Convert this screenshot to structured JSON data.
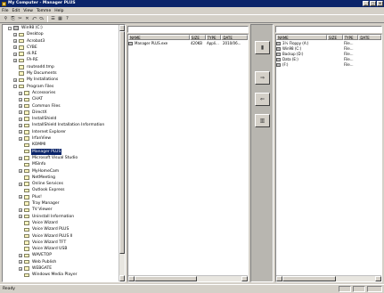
{
  "window": {
    "title": "My Computer - Manager PLUS",
    "min": "_",
    "max": "□",
    "close": "×"
  },
  "menu": [
    "File",
    "Edit",
    "View",
    "Tomme",
    "Help"
  ],
  "toolbar": [
    "⚲",
    "⎘",
    "✂",
    "✕",
    "⤺",
    "⤼",
    "☰",
    "▦",
    "?"
  ],
  "tree": [
    {
      "label": "Win98 (C:)",
      "indent": 3,
      "exp": "-",
      "icon": "drive",
      "selected": false
    },
    {
      "label": "Desktop",
      "indent": 4,
      "exp": "+",
      "icon": "folder",
      "selected": false
    },
    {
      "label": "Acrobat3",
      "indent": 4,
      "exp": "+",
      "icon": "folder",
      "selected": false
    },
    {
      "label": "CYBE",
      "indent": 4,
      "exp": "+",
      "icon": "folder",
      "selected": false
    },
    {
      "label": "di.RE",
      "indent": 4,
      "exp": "+",
      "icon": "folder",
      "selected": false
    },
    {
      "label": "FA-RE",
      "indent": 4,
      "exp": "+",
      "icon": "folder",
      "selected": false
    },
    {
      "label": "routeadd.tmp",
      "indent": 4,
      "exp": "",
      "icon": "folder",
      "selected": false
    },
    {
      "label": "My Documents",
      "indent": 4,
      "exp": "",
      "icon": "folder",
      "selected": false
    },
    {
      "label": "My Installations",
      "indent": 4,
      "exp": "+",
      "icon": "folder",
      "selected": false
    },
    {
      "label": "Program Files",
      "indent": 4,
      "exp": "-",
      "icon": "folder",
      "selected": false
    },
    {
      "label": "Accessories",
      "indent": 5,
      "exp": "+",
      "icon": "folder",
      "selected": false
    },
    {
      "label": "CHAT",
      "indent": 5,
      "exp": "+",
      "icon": "folder",
      "selected": false
    },
    {
      "label": "Common Files",
      "indent": 5,
      "exp": "+",
      "icon": "folder",
      "selected": false
    },
    {
      "label": "DirectX",
      "indent": 5,
      "exp": "+",
      "icon": "folder",
      "selected": false
    },
    {
      "label": "InstallShield",
      "indent": 5,
      "exp": "+",
      "icon": "folder",
      "selected": false
    },
    {
      "label": "InstallShield Installation Information",
      "indent": 5,
      "exp": "+",
      "icon": "folder",
      "selected": false
    },
    {
      "label": "Internet Explorer",
      "indent": 5,
      "exp": "+",
      "icon": "folder",
      "selected": false
    },
    {
      "label": "IrfanView",
      "indent": 5,
      "exp": "+",
      "icon": "folder",
      "selected": false
    },
    {
      "label": "KOMMI",
      "indent": 5,
      "exp": "",
      "icon": "folder",
      "selected": false
    },
    {
      "label": "Manager PLUS",
      "indent": 5,
      "exp": "",
      "icon": "folder",
      "selected": true
    },
    {
      "label": "Microsoft Visual Studio",
      "indent": 5,
      "exp": "+",
      "icon": "folder",
      "selected": false
    },
    {
      "label": "MSInfo",
      "indent": 5,
      "exp": "",
      "icon": "folder",
      "selected": false
    },
    {
      "label": "MyHomeCam",
      "indent": 5,
      "exp": "+",
      "icon": "folder",
      "selected": false
    },
    {
      "label": "NetMeeting",
      "indent": 5,
      "exp": "",
      "icon": "folder",
      "selected": false
    },
    {
      "label": "Online Services",
      "indent": 5,
      "exp": "+",
      "icon": "folder",
      "selected": false
    },
    {
      "label": "Outlook Express",
      "indent": 5,
      "exp": "",
      "icon": "folder",
      "selected": false
    },
    {
      "label": "Plus!",
      "indent": 5,
      "exp": "+",
      "icon": "folder",
      "selected": false
    },
    {
      "label": "Tray Manager",
      "indent": 5,
      "exp": "",
      "icon": "folder",
      "selected": false
    },
    {
      "label": "TV Viewer",
      "indent": 5,
      "exp": "+",
      "icon": "folder",
      "selected": false
    },
    {
      "label": "Uninstall Information",
      "indent": 5,
      "exp": "+",
      "icon": "folder",
      "selected": false
    },
    {
      "label": "Voice Wizard",
      "indent": 5,
      "exp": "",
      "icon": "folder",
      "selected": false
    },
    {
      "label": "Voice Wizard PLUS",
      "indent": 5,
      "exp": "",
      "icon": "folder",
      "selected": false
    },
    {
      "label": "Voice Wizard PLUS II",
      "indent": 5,
      "exp": "",
      "icon": "folder",
      "selected": false
    },
    {
      "label": "Voice Wizard TFT",
      "indent": 5,
      "exp": "",
      "icon": "folder",
      "selected": false
    },
    {
      "label": "Voice Wizard USB",
      "indent": 5,
      "exp": "",
      "icon": "folder",
      "selected": false
    },
    {
      "label": "WAVETOP",
      "indent": 5,
      "exp": "+",
      "icon": "folder",
      "selected": false
    },
    {
      "label": "Web Publish",
      "indent": 5,
      "exp": "+",
      "icon": "folder",
      "selected": false
    },
    {
      "label": "WEBGATE",
      "indent": 5,
      "exp": "+",
      "icon": "folder",
      "selected": false
    },
    {
      "label": "Windows Media Player",
      "indent": 5,
      "exp": "",
      "icon": "folder",
      "selected": false
    }
  ],
  "left_list": {
    "headers": [
      "NAME",
      "SIZE",
      "TYPE",
      "DATE"
    ],
    "rows": [
      {
        "name": "Manager PLUS.exe",
        "size": "420KB",
        "type": "Appli...",
        "date": "2010/06..."
      }
    ]
  },
  "right_list": {
    "headers": [
      "NAME",
      "SIZE",
      "TYPE",
      "DATE"
    ],
    "rows": [
      {
        "name": "3½ Floppy (A:)",
        "size": "",
        "type": "File...",
        "date": ""
      },
      {
        "name": "Win98 (C:)",
        "size": "",
        "type": "File...",
        "date": ""
      },
      {
        "name": "Backup (D:)",
        "size": "",
        "type": "File...",
        "date": ""
      },
      {
        "name": "Data (E:)",
        "size": "",
        "type": "File...",
        "date": ""
      },
      {
        "name": "(F:)",
        "size": "",
        "type": "File...",
        "date": ""
      }
    ]
  },
  "sidebar_buttons": [
    "▮",
    "⇒",
    "⇐",
    "▥"
  ],
  "status": {
    "text": "Ready"
  }
}
